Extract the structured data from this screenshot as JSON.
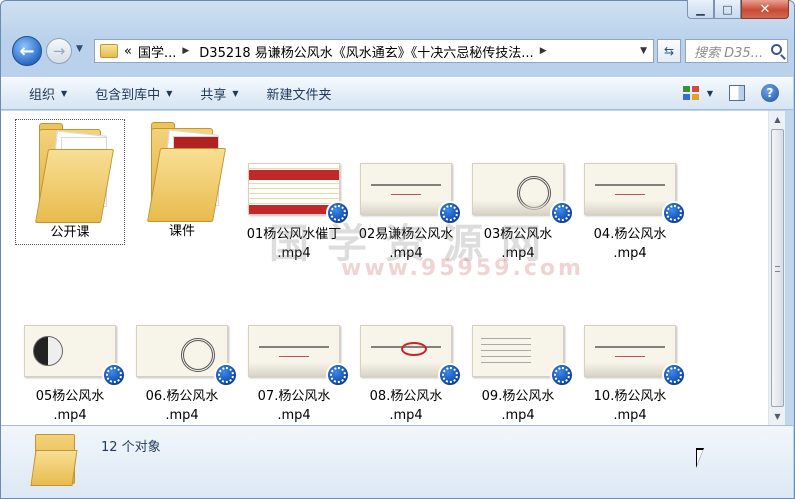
{
  "window": {
    "min_label": "▁",
    "max_label": "□",
    "close_label": "✕"
  },
  "nav": {
    "breadcrumbs": [
      "国学...",
      "D35218 易谦杨公风水《风水通玄》《十决六忌秘传技法..."
    ],
    "lead_chevron": "«",
    "search_placeholder": "搜索 D35..."
  },
  "toolbar": {
    "organize": "组织",
    "include_in_library": "包含到库中",
    "share": "共享",
    "new_folder": "新建文件夹"
  },
  "items": [
    {
      "name": "公开课",
      "kind": "folder-docs"
    },
    {
      "name": "课件",
      "kind": "folder-slides"
    },
    {
      "name": "01杨公风水催丁\n.mp4",
      "kind": "video",
      "thumb": "red"
    },
    {
      "name": "02易谦杨公风水\n.mp4",
      "kind": "video",
      "thumb": "title"
    },
    {
      "name": "03杨公风水\n.mp4",
      "kind": "video",
      "thumb": "chart"
    },
    {
      "name": "04.杨公风水\n.mp4",
      "kind": "video",
      "thumb": "title"
    },
    {
      "name": "05杨公风水\n.mp4",
      "kind": "video",
      "thumb": "chart"
    },
    {
      "name": "06.杨公风水\n.mp4",
      "kind": "video",
      "thumb": "chart"
    },
    {
      "name": "07.杨公风水\n.mp4",
      "kind": "video",
      "thumb": "title"
    },
    {
      "name": "08.杨公风水\n.mp4",
      "kind": "video",
      "thumb": "scribble"
    },
    {
      "name": "09.杨公风水\n.mp4",
      "kind": "video",
      "thumb": "text"
    },
    {
      "name": "10.杨公风水\n.mp4",
      "kind": "video",
      "thumb": "title"
    }
  ],
  "watermark": {
    "text": "国学资源网",
    "url": "www.95959.com"
  },
  "details": {
    "count": "12 个对象"
  },
  "colors": {
    "accent": "#1e395b",
    "close": "#c94a33",
    "folder": "#e8bb4d"
  }
}
